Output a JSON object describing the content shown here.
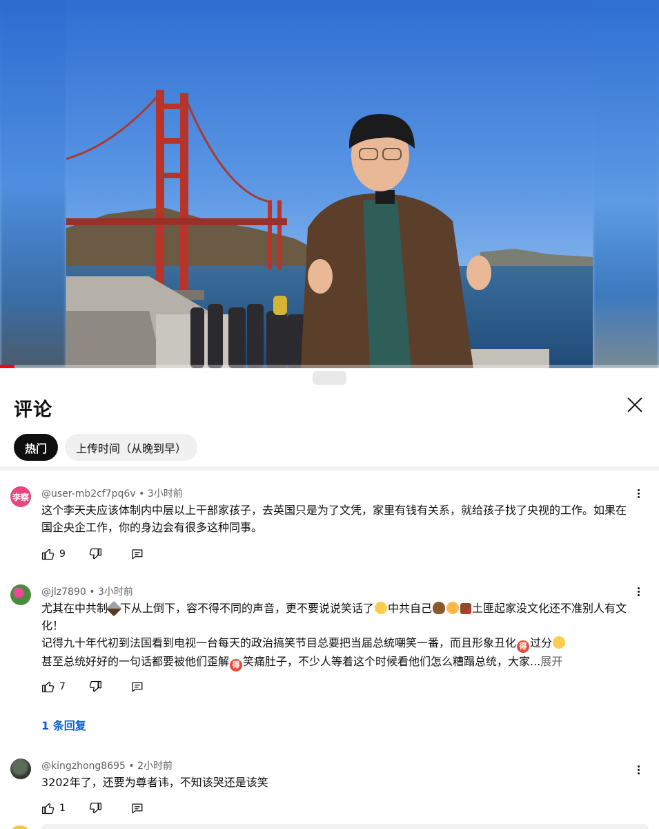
{
  "video": {
    "progress_fraction": 0.022,
    "colors": {
      "progress": "#ff0000",
      "sky": "#4c8be0",
      "bridge": "#c0392b"
    }
  },
  "comments_panel": {
    "title": "评论",
    "sort_tabs": [
      {
        "label": "热门",
        "active": true
      },
      {
        "label": "上传时间（从晚到早）",
        "active": false
      }
    ],
    "close_icon": "close-icon"
  },
  "comments": [
    {
      "avatar_text": "李察",
      "avatar_color": "#e8467c",
      "handle": "@user-mb2cf7pq6v",
      "time": "3小时前",
      "text": "这个李天夫应该体制内中层以上干部家孩子，去英国只是为了文凭，家里有钱有关系，就给孩子找了央视的工作。如果在国企央企工作，你的身边会有很多这种同事。",
      "likes": "9"
    },
    {
      "handle": "@jlz7890",
      "time": "3小时前",
      "line1_a": "尤其在中共制",
      "line1_b": "下从上倒下，容不得不同的声音，更不要说说笑话了",
      "line1_c": "中共自己",
      "line1_d": "土匪起家没文化还不准别人有文化！",
      "line2_a": "记得九十年代初到法国看到电视一台每天的政治搞笑节目总要把当届总统嘲笑一番，而且形象丑化",
      "line2_b": "过分",
      "line3_a": "甚至总统好好的一句话都要被他们歪解",
      "line3_b": "笑痛肚子，不少人等着这个时候看他们怎么糟蹋总统，大家...",
      "emoji_de": "得",
      "expand_label": "展开",
      "likes": "7",
      "replies_label": "1 条回复"
    },
    {
      "handle": "@kingzhong8695",
      "time": "2小时前",
      "text": "3202年了，还要为尊者讳，不知该哭还是该笑",
      "likes": "1"
    }
  ],
  "separator": "•"
}
